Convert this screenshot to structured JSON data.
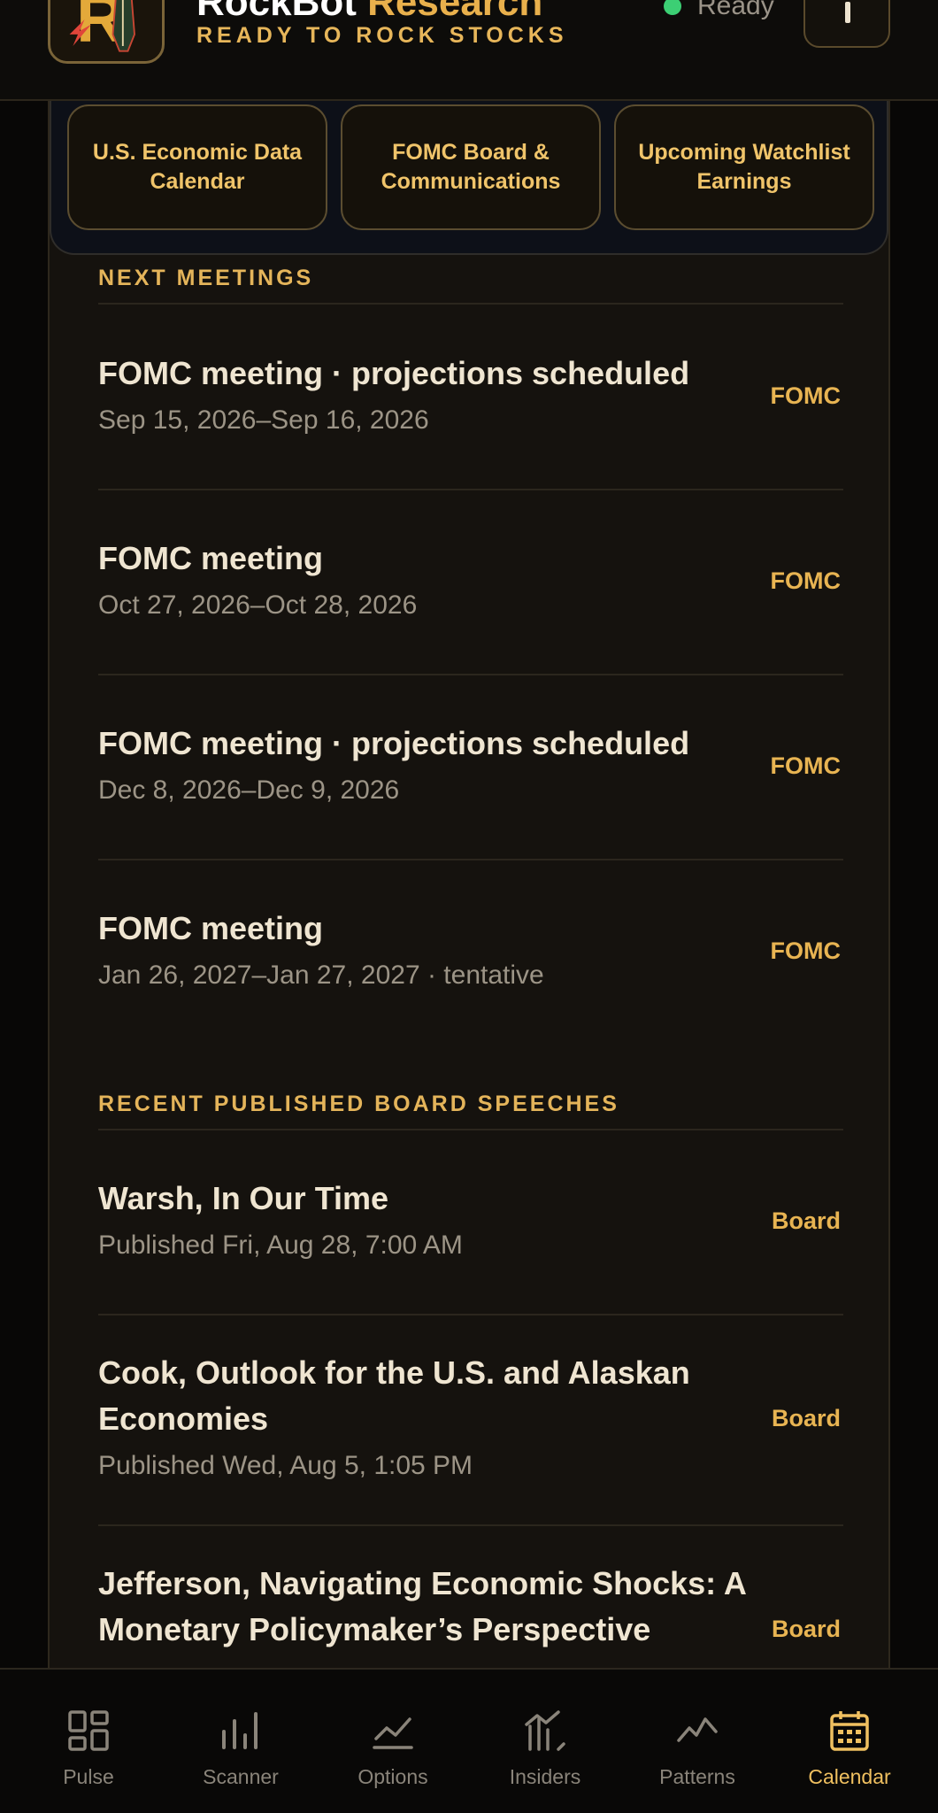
{
  "header": {
    "brand_title_main": "RockBot",
    "brand_title_accent": "Research",
    "tagline": "READY TO ROCK STOCKS",
    "status_text": "Ready",
    "logo_letter": "R"
  },
  "tabs": [
    {
      "label": "U.S. Economic Data Calendar"
    },
    {
      "label": "FOMC Board & Communications"
    },
    {
      "label": "Upcoming Watchlist Earnings"
    }
  ],
  "meetings": {
    "section_label": "NEXT MEETINGS",
    "items": [
      {
        "title": "FOMC meeting · projections scheduled",
        "date": "Sep 15, 2026–Sep 16, 2026",
        "badge": "FOMC"
      },
      {
        "title": "FOMC meeting",
        "date": "Oct 27, 2026–Oct 28, 2026",
        "badge": "FOMC"
      },
      {
        "title": "FOMC meeting · projections scheduled",
        "date": "Dec 8, 2026–Dec 9, 2026",
        "badge": "FOMC"
      },
      {
        "title": "FOMC meeting",
        "date": "Jan 26, 2027–Jan 27, 2027 · tentative",
        "badge": "FOMC"
      }
    ]
  },
  "speeches": {
    "section_label": "RECENT PUBLISHED BOARD SPEECHES",
    "items": [
      {
        "title": "Warsh, In Our Time",
        "published": "Published Fri, Aug 28, 7:00 AM",
        "badge": "Board"
      },
      {
        "title": "Cook, Outlook for the U.S. and Alaskan Economies",
        "published": "Published Wed, Aug 5, 1:05 PM",
        "badge": "Board"
      },
      {
        "title": "Jefferson, Navigating Economic Shocks: A Monetary Policymaker’s Perspective",
        "published": "",
        "badge": "Board"
      }
    ]
  },
  "nav": {
    "items": [
      {
        "label": "Pulse",
        "icon": "pulse-icon"
      },
      {
        "label": "Scanner",
        "icon": "scanner-icon"
      },
      {
        "label": "Options",
        "icon": "options-icon"
      },
      {
        "label": "Insiders",
        "icon": "insiders-icon"
      },
      {
        "label": "Patterns",
        "icon": "patterns-icon"
      },
      {
        "label": "Calendar",
        "icon": "calendar-icon",
        "active": true
      }
    ]
  },
  "colors": {
    "accent": "#e8b452",
    "status_ready": "#3ccf74",
    "background": "#15120e"
  }
}
